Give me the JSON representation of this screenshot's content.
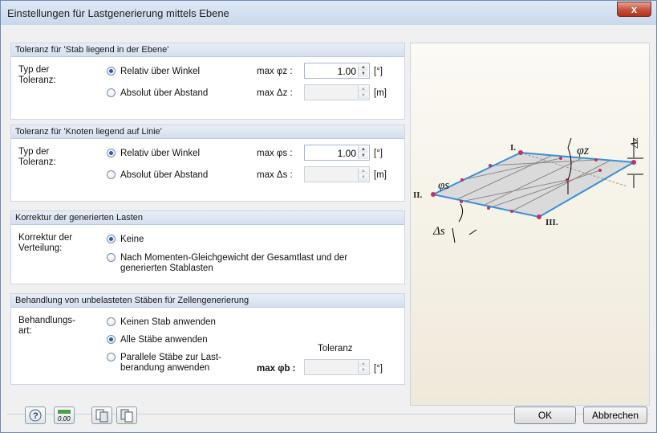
{
  "window": {
    "title": "Einstellungen für Lastgenerierung mittels Ebene",
    "close_glyph": "x"
  },
  "section1": {
    "header": "Toleranz für 'Stab liegend in der Ebene'",
    "type_label": "Typ der Toleranz:",
    "option1": "Relativ über Winkel",
    "option2": "Absolut über Abstand",
    "selected": "Relativ über Winkel",
    "max1_label": "max φz :",
    "max1_value": "1.00",
    "max1_unit": "[°]",
    "max2_label": "max Δz :",
    "max2_value": "",
    "max2_unit": "[m]"
  },
  "section2": {
    "header": "Toleranz für 'Knoten liegend auf Linie'",
    "type_label": "Typ der Toleranz:",
    "option1": "Relativ über Winkel",
    "option2": "Absolut über Abstand",
    "selected": "Relativ über Winkel",
    "max1_label": "max φs :",
    "max1_value": "1.00",
    "max1_unit": "[°]",
    "max2_label": "max Δs :",
    "max2_value": "",
    "max2_unit": "[m]"
  },
  "section3": {
    "header": "Korrektur der generierten Lasten",
    "type_label": "Korrektur der Verteilung:",
    "option1": "Keine",
    "option2": "Nach Momenten-Gleichgewicht der Gesamtlast und der generierten Stablasten",
    "selected": "Keine"
  },
  "section4": {
    "header": "Behandlung von unbelasteten Stäben für Zellengenerierung",
    "type_label": "Behandlungs-art:",
    "option1": "Keinen Stab anwenden",
    "option2": "Alle Stäbe anwenden",
    "option3": "Parallele Stäbe zur Last-berandung anwenden",
    "selected": "Alle Stäbe anwenden",
    "tolerance_label": "Toleranz",
    "max_label": "max φb :",
    "max_value": "",
    "max_unit": "[°]"
  },
  "illustration": {
    "labels": {
      "node1": "I.",
      "node2": "II.",
      "node3": "III.",
      "phi_z": "φz",
      "phi_s": "φs",
      "delta_s": "Δs",
      "delta_z": "Δz"
    },
    "colors": {
      "edge": "#3a8fd6",
      "node": "#c0306a",
      "plane_fill": "#d8d8d8",
      "grid": "#8a8a8a"
    }
  },
  "footer": {
    "icons": [
      "help-icon",
      "decimal-icon",
      "copy-settings-icon",
      "paste-settings-icon"
    ],
    "decimal_icon_text": "0.00",
    "ok_label": "OK",
    "cancel_label": "Abbrechen"
  }
}
